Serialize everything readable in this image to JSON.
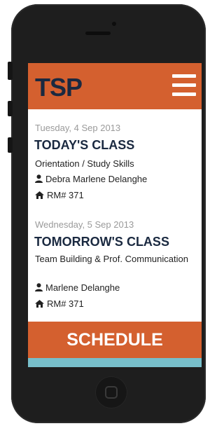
{
  "app": {
    "logo": "TSP"
  },
  "colors": {
    "accent": "#d4602f",
    "navy": "#1a2940",
    "teal": "#78bfca"
  },
  "today": {
    "date": "Tuesday, 4 Sep 2013",
    "heading": "TODAY'S CLASS",
    "course": "Orientation / Study Skills",
    "instructor": "Debra Marlene Delanghe",
    "room": "RM# 371"
  },
  "tomorrow": {
    "date": "Wednesday, 5 Sep 2013",
    "heading": "TOMORROW'S CLASS",
    "course": "Team Building & Prof. Communication",
    "instructor": "Marlene Delanghe",
    "room": "RM# 371"
  },
  "footer": {
    "schedule_label": "SCHEDULE"
  },
  "icons": {
    "menu": "hamburger-icon",
    "user": "user-icon",
    "room": "home-icon"
  }
}
